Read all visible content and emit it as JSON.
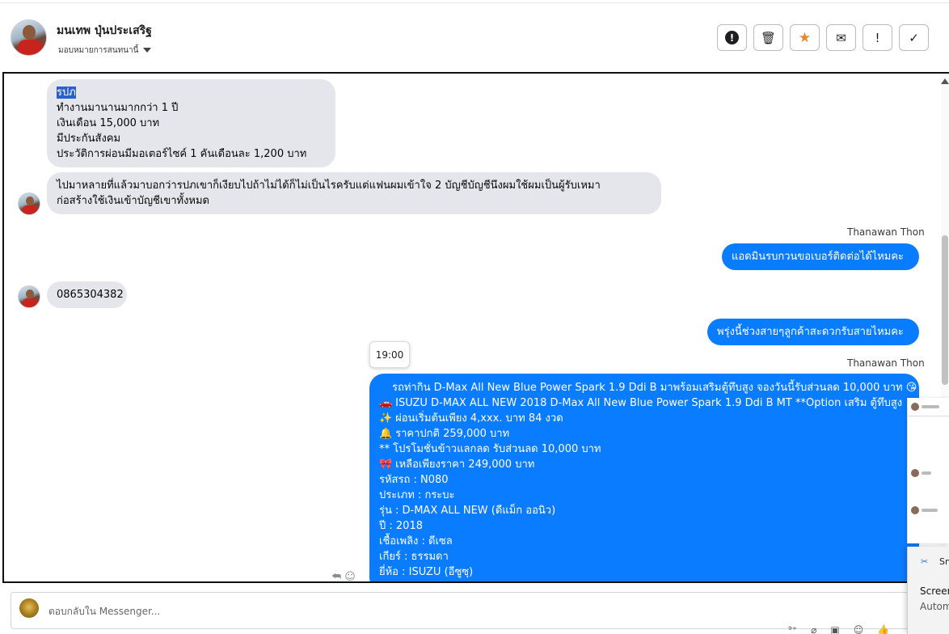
{
  "header": {
    "contact_name": "มนเทพ ปุ่นประเสริฐ",
    "assign_label": "มอบหมายการสนทนานี้",
    "actions": {
      "spam": "!",
      "trash": "🗑",
      "star": "★",
      "mail": "✉",
      "important": "!",
      "done": "✓"
    }
  },
  "messages": {
    "m1_lines": [
      "รปภ",
      "ทำงานมานานมากกว่า 1 ปี",
      "เงินเดือน 15,000 บาท",
      "มีประกันสังคม",
      "ประวัติการผ่อนมีมอเตอร์ไซค์ 1 คันเดือนละ 1,200 บาท"
    ],
    "m2_lines": [
      "ไปมาหลายที่แล้วมาบอกว่ารปภเขาก็เงียบไปถ้าไม่ได้ก็ไม่เป็นไรครับแต่แฟนผมเข้าใจ 2 บัญชีบัญชีนึงผมใช้ผมเป็นผู้รับเหมา",
      "ก่อสร้างใช้เงินเข้าบัญชีเขาทั้งหมด"
    ],
    "sender_1": "Thanawan Thon",
    "m3": "แอดมินรบกวนขอเบอร์ติดต่อได้ไหมคะ",
    "m4": "0865304382",
    "m5": "พรุ่งนี้ช่วงสายๆลูกค้าสะดวกรับสายไหมคะ",
    "time_tooltip": "19:00",
    "sender_2": "Thanawan Thon",
    "m6_lines": [
      {
        "emoji": "",
        "text": "รถท่ากิน D-Max All New Blue Power Spark 1.9 Ddi B  มาพร้อมเสริมตู้ทึบสูง จองวันนี้รับส่วนลด 10,000 บาท 😘"
      },
      {
        "emoji": "🚗",
        "text": " ISUZU D-MAX ALL NEW 2018 D-Max All New Blue Power Spark 1.9 Ddi B MT **Option เสริม ตู้ทึบสูง"
      },
      {
        "emoji": "✨",
        "text": " ผ่อนเริ่มต้นเพียง 4,xxx. บาท 84 งวด"
      },
      {
        "emoji": "🔔",
        "text": "  ราคาปกติ 259,000 บาท"
      },
      {
        "emoji": "",
        "text": "** โปรโมชั่นข้าวแลกลด รับส่วนลด 10,000 บาท"
      },
      {
        "emoji": "🎀",
        "text": " เหลือเพียงราคา 249,000 บาท"
      },
      {
        "emoji": "",
        "text": "   รหัสรถ : N080"
      },
      {
        "emoji": "",
        "text": "   ประเภท : กระบะ"
      },
      {
        "emoji": "",
        "text": "   รุ่น : D-MAX ALL NEW (ดีแม็ก ออนิว)"
      },
      {
        "emoji": "",
        "text": "   ปี : 2018"
      },
      {
        "emoji": "",
        "text": "   เชื้อเพลิง : ดีเซล"
      },
      {
        "emoji": "",
        "text": "   เกียร์ : ธรรมดา"
      },
      {
        "emoji": "",
        "text": "   ยี่ห้อ : ISUZU (อีซูซุ)"
      }
    ]
  },
  "composer": {
    "placeholder": "ตอบกลับใน Messenger..."
  },
  "notification": {
    "app": "Snipping Tool",
    "title": "Screenshot copied to clipboard",
    "subtitle": "Automatically saved to screenshots folder"
  },
  "colors": {
    "outgoing_bubble": "#0a7cff",
    "incoming_bubble": "#e4e6eb",
    "star": "#e8862d"
  }
}
